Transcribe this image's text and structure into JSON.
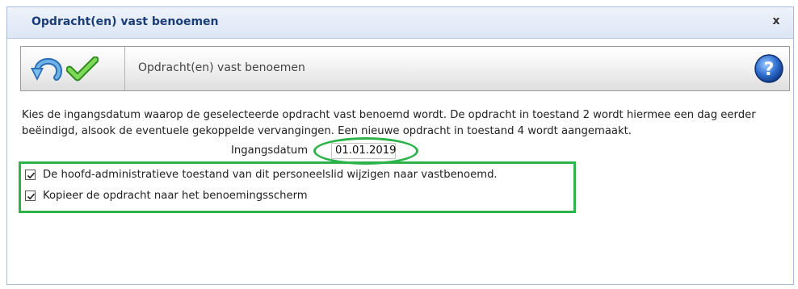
{
  "window": {
    "title": "Opdracht(en) vast benoemen",
    "close_label": "x"
  },
  "toolbar": {
    "title": "Opdracht(en) vast benoemen",
    "icons": [
      "undo-icon",
      "checkmark-icon",
      "help-icon"
    ]
  },
  "main": {
    "description": "Kies de ingangsdatum waarop de geselecteerde opdracht vast benoemd wordt. De opdracht in toestand 2 wordt hiermee een dag eerder beëindigd, alsook de eventuele gekoppelde vervangingen. Een nieuwe opdracht in toestand 4 wordt aangemaakt.",
    "date_label": "Ingangsdatum",
    "date_value": "01.01.2019",
    "checkboxes": [
      {
        "label": "De hoofd-administratieve toestand van dit personeelslid wijzigen naar vastbenoemd.",
        "checked": true
      },
      {
        "label": "Kopieer de opdracht naar het benoemingsscherm",
        "checked": true
      }
    ]
  },
  "colors": {
    "highlight": "#2db34a",
    "title_text": "#1a3d78"
  }
}
